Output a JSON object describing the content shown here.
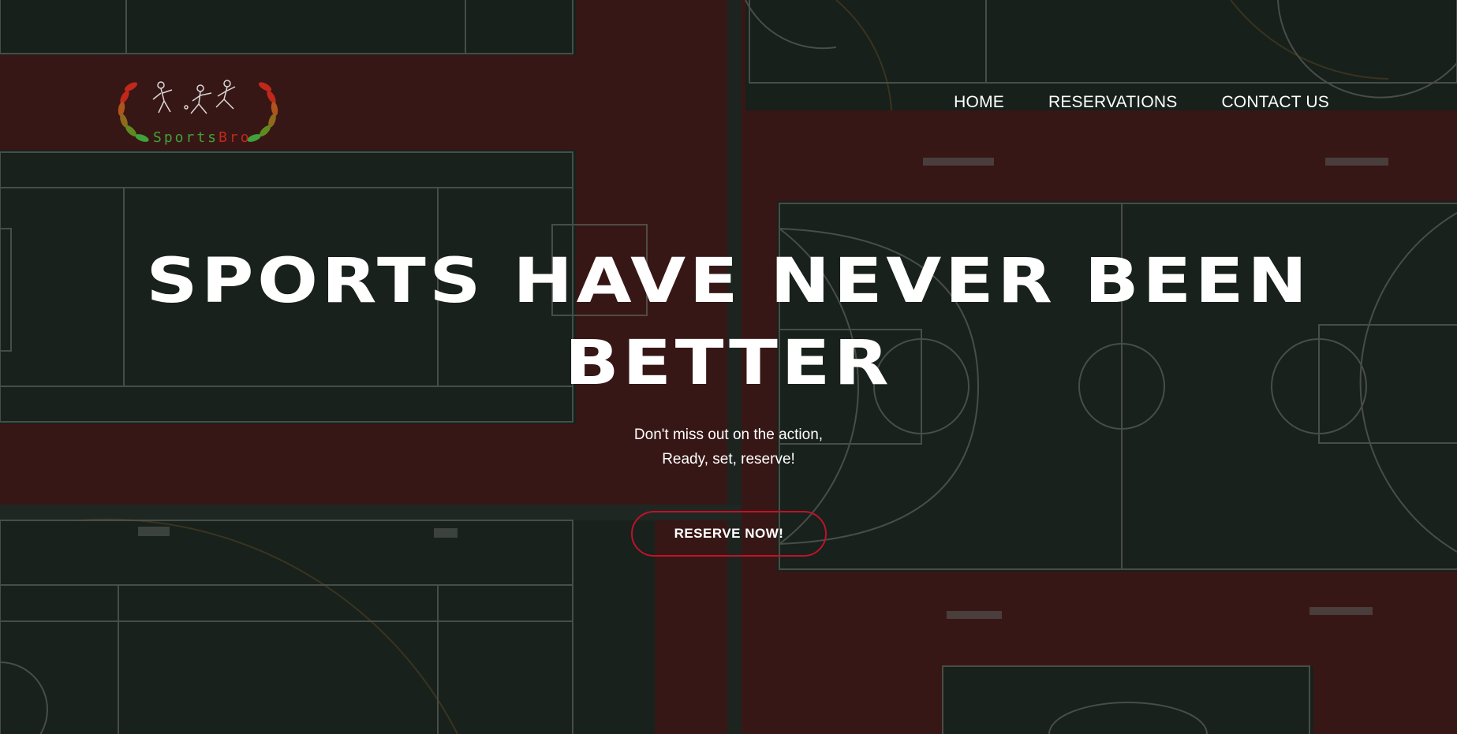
{
  "brand": {
    "logo_text_a": "Sports",
    "logo_text_b": "Bro"
  },
  "nav": {
    "items": [
      {
        "label": "HOME"
      },
      {
        "label": "RESERVATIONS"
      },
      {
        "label": "CONTACT US"
      }
    ]
  },
  "hero": {
    "headline_line1": "Sports have never been",
    "headline_line2": "better",
    "subtitle_line1": "Don't miss out on the action,",
    "subtitle_line2": "Ready, set, reserve!",
    "cta_label": "RESERVE NOW!"
  },
  "colors": {
    "accent": "#c0122a",
    "court_green": "#26352c",
    "track_red": "#6b2a26",
    "text": "#ffffff"
  }
}
